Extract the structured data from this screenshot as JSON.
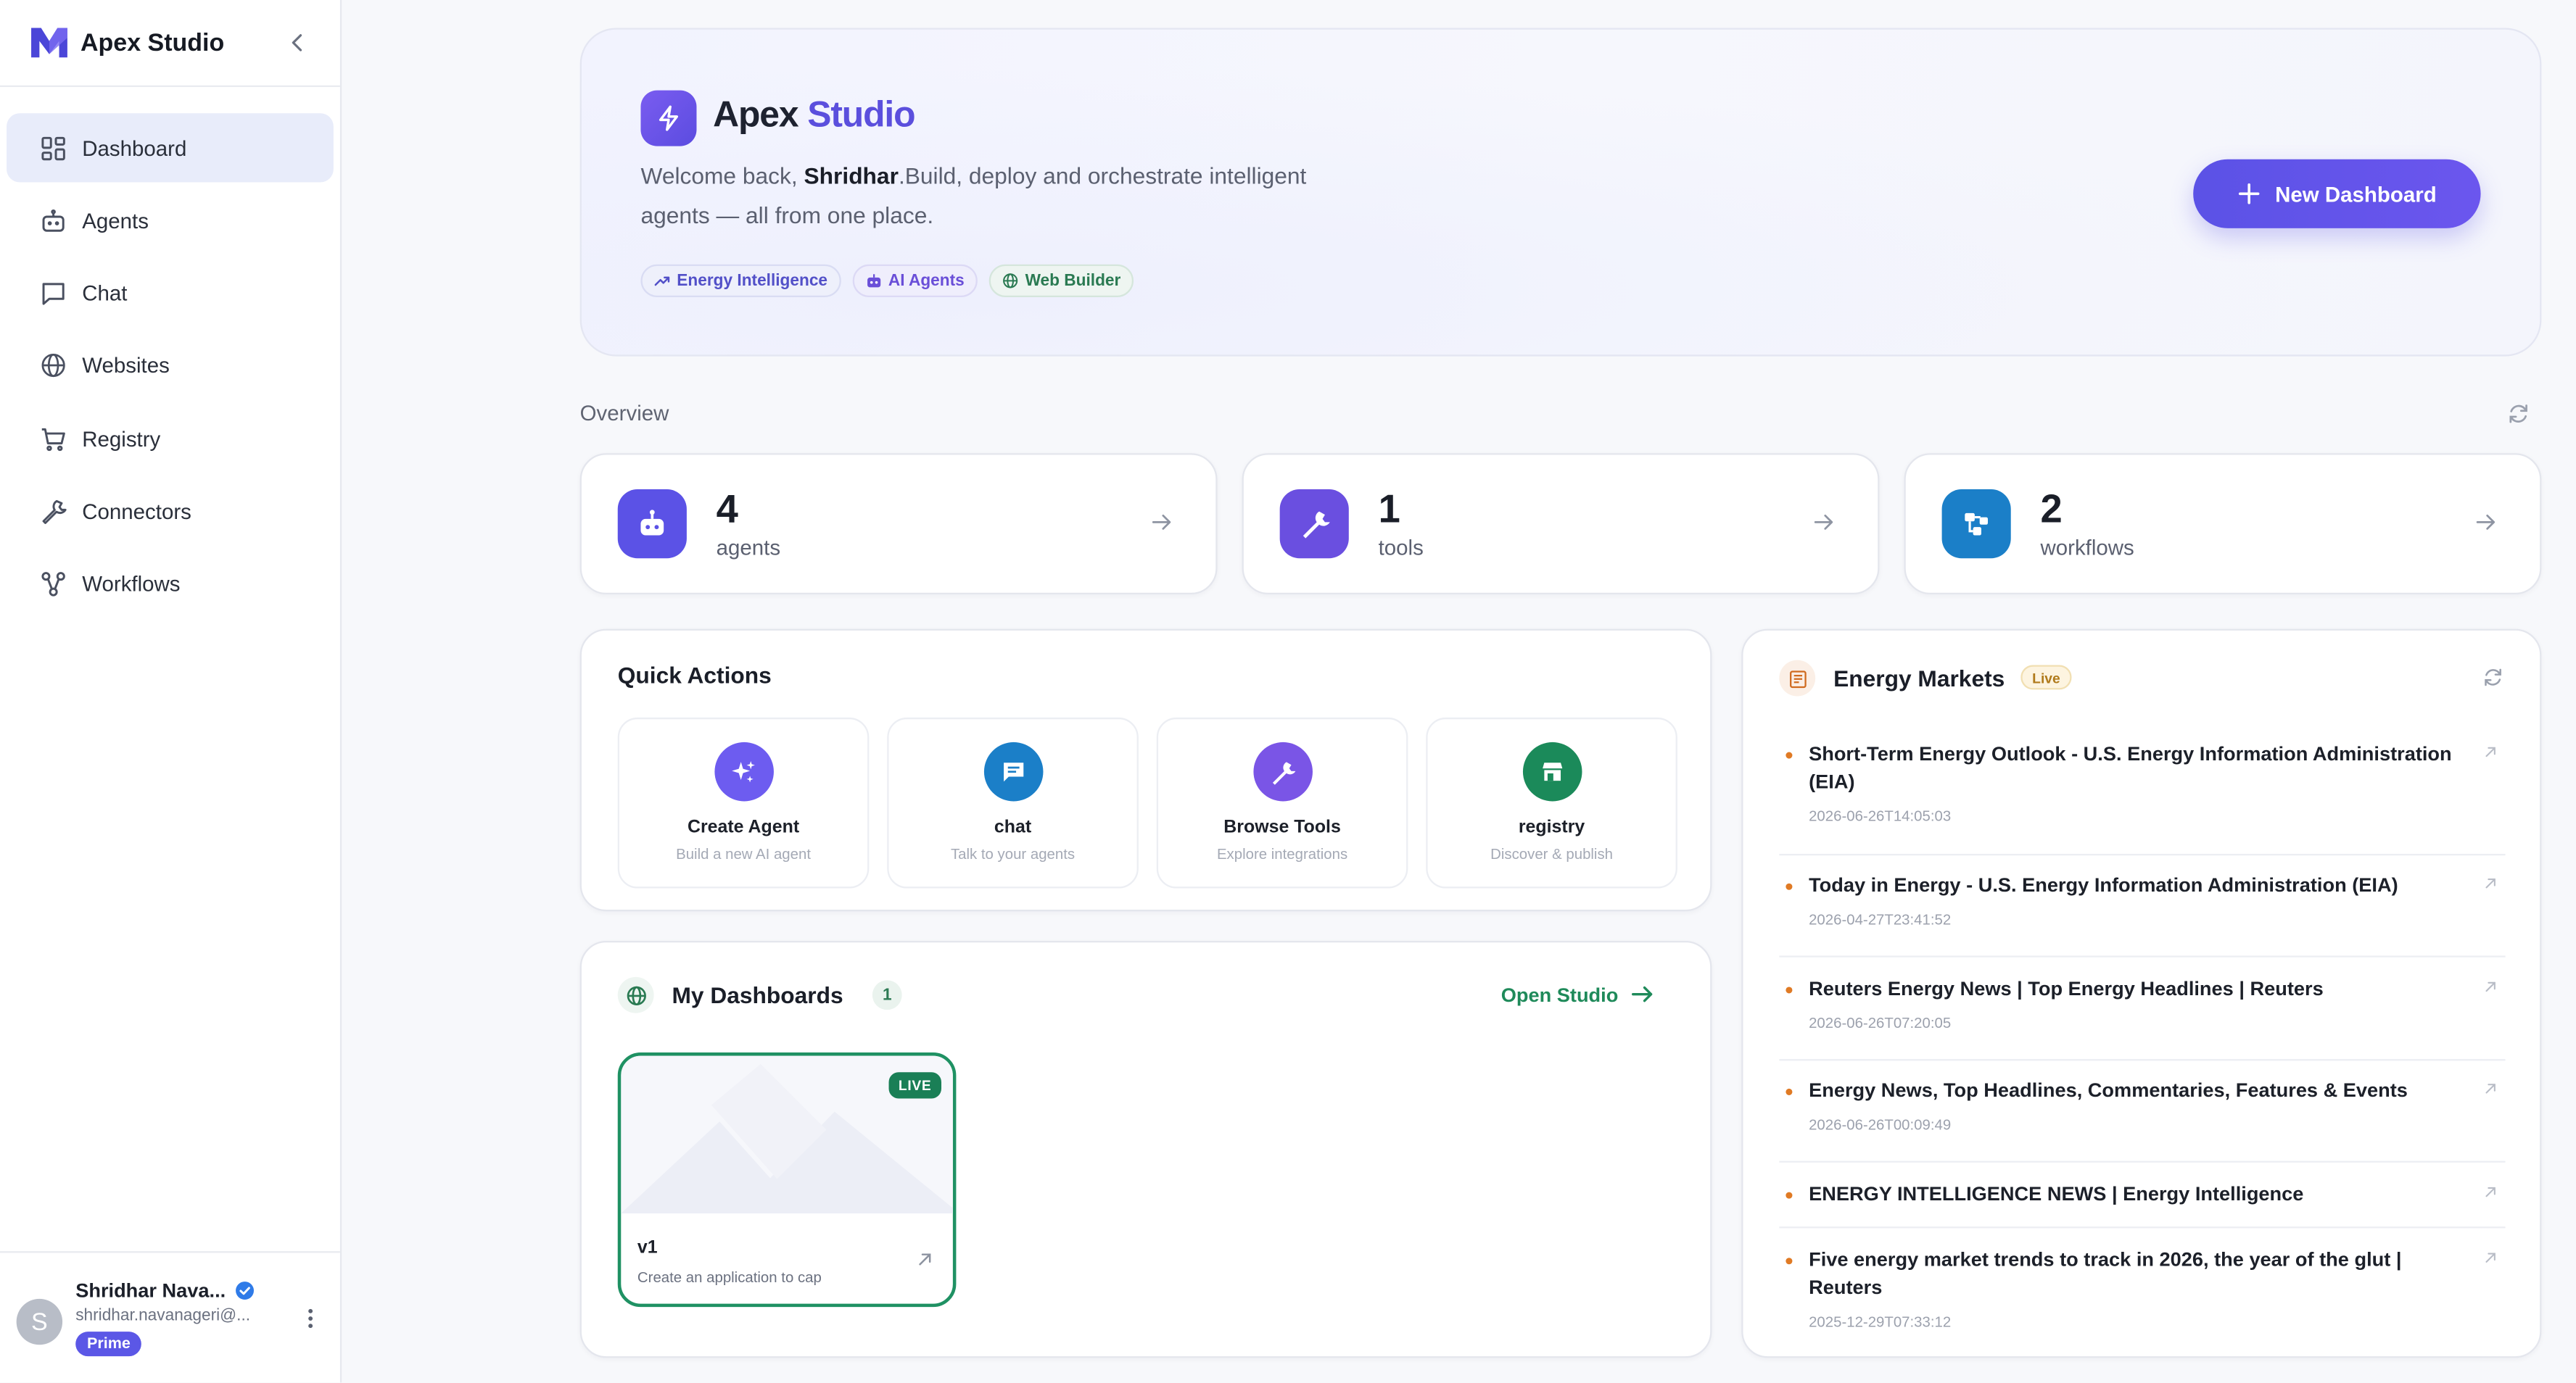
{
  "app": {
    "name": "Apex Studio"
  },
  "sidebar": {
    "items": [
      {
        "label": "Dashboard",
        "icon": "dashboard-icon",
        "active": true
      },
      {
        "label": "Agents",
        "icon": "bot-icon"
      },
      {
        "label": "Chat",
        "icon": "chat-icon"
      },
      {
        "label": "Websites",
        "icon": "globe-icon"
      },
      {
        "label": "Registry",
        "icon": "cart-icon"
      },
      {
        "label": "Connectors",
        "icon": "wrench-icon"
      },
      {
        "label": "Workflows",
        "icon": "workflow-icon"
      }
    ],
    "user": {
      "initial": "S",
      "name": "Shridhar Nava...",
      "email": "shridhar.navanageri@...",
      "plan": "Prime"
    }
  },
  "hero": {
    "title_part1": "Apex",
    "title_part2": "Studio",
    "welcome": "Welcome back,",
    "user": "Shridhar",
    "subtitle": ".Build, deploy and orchestrate intelligent agents — all from one place.",
    "chips": [
      "Energy Intelligence",
      "AI Agents",
      "Web Builder"
    ],
    "button": "New Dashboard"
  },
  "overview": {
    "label": "Overview",
    "stats": [
      {
        "value": "4",
        "label": "agents",
        "color": "#5b52e6"
      },
      {
        "value": "1",
        "label": "tools",
        "color": "#6a4fe0"
      },
      {
        "value": "2",
        "label": "workflows",
        "color": "#1b7fc8"
      }
    ]
  },
  "quick_actions": {
    "title": "Quick Actions",
    "items": [
      {
        "name": "Create Agent",
        "desc": "Build a new AI agent",
        "color": "#6d5cf0"
      },
      {
        "name": "chat",
        "desc": "Talk to your agents",
        "color": "#1b7fc8"
      },
      {
        "name": "Browse Tools",
        "desc": "Explore integrations",
        "color": "#7a55e6"
      },
      {
        "name": "registry",
        "desc": "Discover & publish",
        "color": "#1b8a5a"
      }
    ]
  },
  "dashboards": {
    "title": "My Dashboards",
    "count": "1",
    "open_label": "Open Studio",
    "items": [
      {
        "badge": "LIVE",
        "name": "v1",
        "desc": "Create an application to cap"
      }
    ]
  },
  "energy": {
    "title": "Energy Markets",
    "badge": "Live",
    "news": [
      {
        "title": "Short-Term Energy Outlook - U.S. Energy Information Administration (EIA)",
        "time": "2026-06-26T14:05:03"
      },
      {
        "title": "Today in Energy - U.S. Energy Information Administration (EIA)",
        "time": "2026-04-27T23:41:52"
      },
      {
        "title": "Reuters Energy News | Top Energy Headlines | Reuters",
        "time": "2026-06-26T07:20:05"
      },
      {
        "title": "Energy News, Top Headlines, Commentaries, Features & Events",
        "time": "2026-06-26T00:09:49"
      },
      {
        "title": "ENERGY INTELLIGENCE NEWS | Energy Intelligence",
        "time": ""
      },
      {
        "title": "Five energy market trends to track in 2026, the year of the glut | Reuters",
        "time": "2025-12-29T07:33:12"
      }
    ]
  }
}
